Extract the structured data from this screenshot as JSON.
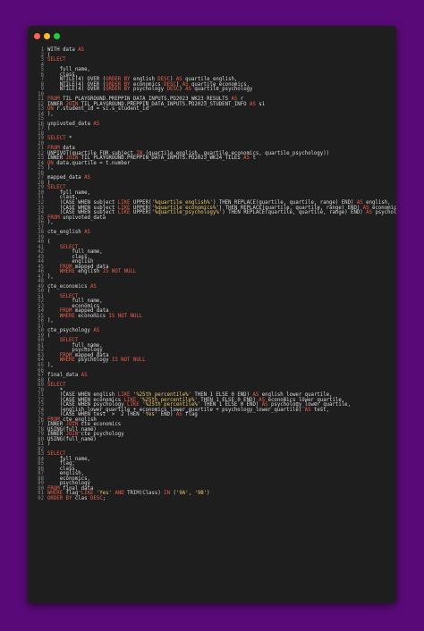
{
  "window": {
    "traffic_lights": [
      {
        "name": "close",
        "color": "#ff5f56"
      },
      {
        "name": "minimize",
        "color": "#ffbd2e"
      },
      {
        "name": "maximize",
        "color": "#27c93f"
      }
    ]
  },
  "colors": {
    "background": "#5a0a78",
    "editor": "#1e1e1e",
    "text": "#d8d8d8",
    "keyword": "#e2604a",
    "string": "#e8c46a",
    "line_number": "#8a8a8a"
  },
  "lines": [
    [
      [
        "t",
        "WITH data "
      ],
      [
        "k",
        "AS"
      ]
    ],
    [
      [
        "t",
        "("
      ]
    ],
    [
      [
        "k",
        "SELECT"
      ]
    ],
    [
      [
        "t",
        ""
      ]
    ],
    [
      [
        "t",
        "    full_name,"
      ]
    ],
    [
      [
        "t",
        "    class,"
      ]
    ],
    [
      [
        "t",
        "    NTILE(4) OVER ("
      ],
      [
        "k",
        "ORDER BY"
      ],
      [
        "t",
        " english "
      ],
      [
        "k",
        "DESC"
      ],
      [
        "t",
        ") "
      ],
      [
        "k",
        "AS"
      ],
      [
        "t",
        " quartile_english,"
      ]
    ],
    [
      [
        "t",
        "    NTILE(4) OVER ("
      ],
      [
        "k",
        "ORDER BY"
      ],
      [
        "t",
        " economics "
      ],
      [
        "k",
        "DESC"
      ],
      [
        "t",
        ") "
      ],
      [
        "k",
        "AS"
      ],
      [
        "t",
        " quartile_economics,"
      ]
    ],
    [
      [
        "t",
        "    NTILE(4) OVER ("
      ],
      [
        "k",
        "ORDER BY"
      ],
      [
        "t",
        " psychology "
      ],
      [
        "k",
        "DESC"
      ],
      [
        "t",
        ") "
      ],
      [
        "k",
        "AS"
      ],
      [
        "t",
        " quartile_psychology"
      ]
    ],
    [
      [
        "t",
        ""
      ]
    ],
    [
      [
        "k",
        "FROM"
      ],
      [
        "t",
        " TIL_PLAYGROUND.PREPPIN_DATA_INPUTS.PD2023_WK23_RESULTS "
      ],
      [
        "k",
        "AS"
      ],
      [
        "t",
        " r"
      ]
    ],
    [
      [
        "t",
        "INNER "
      ],
      [
        "k",
        "JOIN"
      ],
      [
        "t",
        " TIL_PLAYGROUND.PREPPIN_DATA_INPUTS.PD2023_STUDENT_INFO "
      ],
      [
        "k",
        "AS"
      ],
      [
        "t",
        " si"
      ]
    ],
    [
      [
        "k",
        "ON"
      ],
      [
        "t",
        " r.student_id = si.s_student_id"
      ]
    ],
    [
      [
        "t",
        "),"
      ]
    ],
    [
      [
        "t",
        ""
      ]
    ],
    [
      [
        "t",
        "unpivoted_data "
      ],
      [
        "k",
        "AS"
      ]
    ],
    [
      [
        "t",
        "("
      ]
    ],
    [
      [
        "t",
        ""
      ]
    ],
    [
      [
        "k",
        "SELECT"
      ],
      [
        "t",
        " *"
      ]
    ],
    [
      [
        "t",
        ""
      ]
    ],
    [
      [
        "k",
        "FROM"
      ],
      [
        "t",
        " data"
      ]
    ],
    [
      [
        "t",
        "UNPIVOT(quartile FOR subject "
      ],
      [
        "k",
        "IN"
      ],
      [
        "t",
        " (quartile_english, quartile_economics, quartile_psychology))"
      ]
    ],
    [
      [
        "t",
        "INNER "
      ],
      [
        "k",
        "JOIN"
      ],
      [
        "t",
        " TIL_PLAYGROUND.PREPPIN_DATA_INPUTS.PD2023_WK24_TILES "
      ],
      [
        "k",
        "AS"
      ],
      [
        "t",
        " t"
      ]
    ],
    [
      [
        "k",
        "ON"
      ],
      [
        "t",
        " data.quartile = t.number"
      ]
    ],
    [
      [
        "t",
        "),"
      ]
    ],
    [
      [
        "t",
        ""
      ]
    ],
    [
      [
        "t",
        "mapped_data "
      ],
      [
        "k",
        "AS"
      ]
    ],
    [
      [
        "t",
        "("
      ]
    ],
    [
      [
        "k",
        "SELECT"
      ]
    ],
    [
      [
        "t",
        "    full_name,"
      ]
    ],
    [
      [
        "t",
        "    class,"
      ]
    ],
    [
      [
        "t",
        "    (CASE WHEN subject "
      ],
      [
        "k",
        "LIKE"
      ],
      [
        "t",
        " UPPER("
      ],
      [
        "s",
        "'%quartile_english%'"
      ],
      [
        "t",
        ") THEN REPLACE(quartile, quartile, range) END) "
      ],
      [
        "k",
        "AS"
      ],
      [
        "t",
        " english,"
      ]
    ],
    [
      [
        "t",
        "    (CASE WHEN subject "
      ],
      [
        "k",
        "LIKE"
      ],
      [
        "t",
        " UPPER("
      ],
      [
        "s",
        "'%quartile_economics%'"
      ],
      [
        "t",
        ") THEN REPLACE(quartile, quartile, range) END) "
      ],
      [
        "k",
        "AS"
      ],
      [
        "t",
        " economics,"
      ]
    ],
    [
      [
        "t",
        "    (CASE WHEN subject "
      ],
      [
        "k",
        "LIKE"
      ],
      [
        "t",
        " UPPER("
      ],
      [
        "s",
        "'%quartile_psychology%'"
      ],
      [
        "t",
        ") THEN REPLACE(quartile, quartile, range) END) "
      ],
      [
        "k",
        "AS"
      ],
      [
        "t",
        " psychology"
      ]
    ],
    [
      [
        "k",
        "FROM"
      ],
      [
        "t",
        " unpivoted_data"
      ]
    ],
    [
      [
        "t",
        "),"
      ]
    ],
    [
      [
        "t",
        ""
      ]
    ],
    [
      [
        "t",
        "cte_english "
      ],
      [
        "k",
        "AS"
      ]
    ],
    [
      [
        "t",
        ""
      ]
    ],
    [
      [
        "t",
        "("
      ]
    ],
    [
      [
        "t",
        "    "
      ],
      [
        "k",
        "SELECT"
      ]
    ],
    [
      [
        "t",
        "        full_name,"
      ]
    ],
    [
      [
        "t",
        "        class,"
      ]
    ],
    [
      [
        "t",
        "        english"
      ]
    ],
    [
      [
        "t",
        "    "
      ],
      [
        "k",
        "FROM"
      ],
      [
        "t",
        " mapped_data"
      ]
    ],
    [
      [
        "t",
        "    "
      ],
      [
        "k",
        "WHERE"
      ],
      [
        "t",
        " english "
      ],
      [
        "k",
        "IS NOT NULL"
      ]
    ],
    [
      [
        "t",
        "),"
      ]
    ],
    [
      [
        "t",
        ""
      ]
    ],
    [
      [
        "t",
        "cte_economics "
      ],
      [
        "k",
        "AS"
      ]
    ],
    [
      [
        "t",
        "("
      ]
    ],
    [
      [
        "t",
        "    "
      ],
      [
        "k",
        "SELECT"
      ]
    ],
    [
      [
        "t",
        "        full_name,"
      ]
    ],
    [
      [
        "t",
        "        economics"
      ]
    ],
    [
      [
        "t",
        "    "
      ],
      [
        "k",
        "FROM"
      ],
      [
        "t",
        " mapped_data"
      ]
    ],
    [
      [
        "t",
        "    "
      ],
      [
        "k",
        "WHERE"
      ],
      [
        "t",
        " economics "
      ],
      [
        "k",
        "IS NOT NULL"
      ]
    ],
    [
      [
        "t",
        "),"
      ]
    ],
    [
      [
        "t",
        ""
      ]
    ],
    [
      [
        "t",
        "cte_psychology "
      ],
      [
        "k",
        "AS"
      ]
    ],
    [
      [
        "t",
        "("
      ]
    ],
    [
      [
        "t",
        "    "
      ],
      [
        "k",
        "SELECT"
      ]
    ],
    [
      [
        "t",
        "        full_name,"
      ]
    ],
    [
      [
        "t",
        "        psychology"
      ]
    ],
    [
      [
        "t",
        "    "
      ],
      [
        "k",
        "FROM"
      ],
      [
        "t",
        " mapped_data"
      ]
    ],
    [
      [
        "t",
        "    "
      ],
      [
        "k",
        "WHERE"
      ],
      [
        "t",
        " psychology "
      ],
      [
        "k",
        "IS NOT NULL"
      ]
    ],
    [
      [
        "t",
        "),"
      ]
    ],
    [
      [
        "t",
        ""
      ]
    ],
    [
      [
        "t",
        "final_data "
      ],
      [
        "k",
        "AS"
      ]
    ],
    [
      [
        "t",
        "("
      ]
    ],
    [
      [
        "k",
        "SELECT"
      ]
    ],
    [
      [
        "t",
        "    *,"
      ]
    ],
    [
      [
        "t",
        "    (CASE WHEN english "
      ],
      [
        "k",
        "LIKE"
      ],
      [
        "t",
        " "
      ],
      [
        "s",
        "'%25th percentile%'"
      ],
      [
        "t",
        " THEN 1 ELSE 0 END) "
      ],
      [
        "k",
        "AS"
      ],
      [
        "t",
        " english_lower_quartile,"
      ]
    ],
    [
      [
        "t",
        "    (CASE WHEN economics "
      ],
      [
        "k",
        "LIKE"
      ],
      [
        "t",
        " "
      ],
      [
        "s",
        "'%25th percentile%'"
      ],
      [
        "t",
        " THEN 1 ELSE 0 END) "
      ],
      [
        "k",
        "AS"
      ],
      [
        "t",
        " economics_lower_quartile,"
      ]
    ],
    [
      [
        "t",
        "    (CASE WHEN psychology "
      ],
      [
        "k",
        "LIKE"
      ],
      [
        "t",
        " "
      ],
      [
        "s",
        "'%25th percentile%'"
      ],
      [
        "t",
        " THEN 1 ELSE 0 END) "
      ],
      [
        "k",
        "AS"
      ],
      [
        "t",
        " psychology_lower_quartile,"
      ]
    ],
    [
      [
        "t",
        "    (english_lower_quartile + economics_lower_quartile + psychology_lower_quartile) "
      ],
      [
        "k",
        "AS"
      ],
      [
        "t",
        " test,"
      ]
    ],
    [
      [
        "t",
        "    (CASE WHEN test  >  2 THEN "
      ],
      [
        "s",
        "'Yes'"
      ],
      [
        "t",
        " END) "
      ],
      [
        "k",
        "AS"
      ],
      [
        "t",
        " flag"
      ]
    ],
    [
      [
        "k",
        "FROM"
      ],
      [
        "t",
        " cte_english"
      ]
    ],
    [
      [
        "t",
        "INNER "
      ],
      [
        "k",
        "JOIN"
      ],
      [
        "t",
        " cte_economics"
      ]
    ],
    [
      [
        "t",
        "USING(full_name)"
      ]
    ],
    [
      [
        "t",
        "INNER "
      ],
      [
        "k",
        "JOIN"
      ],
      [
        "t",
        " cte_psychology"
      ]
    ],
    [
      [
        "t",
        "USING(full_name)"
      ]
    ],
    [
      [
        "t",
        ")"
      ]
    ],
    [
      [
        "t",
        ""
      ]
    ],
    [
      [
        "k",
        "SELECT"
      ]
    ],
    [
      [
        "t",
        "    full_name,"
      ]
    ],
    [
      [
        "t",
        "    flag,"
      ]
    ],
    [
      [
        "t",
        "    class,"
      ]
    ],
    [
      [
        "t",
        "    english,"
      ]
    ],
    [
      [
        "t",
        "    economics,"
      ]
    ],
    [
      [
        "t",
        "    psychology"
      ]
    ],
    [
      [
        "k",
        "FROM"
      ],
      [
        "t",
        " final_data"
      ]
    ],
    [
      [
        "k",
        "WHERE"
      ],
      [
        "t",
        " flag "
      ],
      [
        "k",
        "LIKE"
      ],
      [
        "t",
        " "
      ],
      [
        "s",
        "'Yes'"
      ],
      [
        "t",
        " "
      ],
      [
        "k",
        "AND"
      ],
      [
        "t",
        " TRIM(Class) "
      ],
      [
        "k",
        "IN"
      ],
      [
        "t",
        " ("
      ],
      [
        "s",
        "'9A'"
      ],
      [
        "t",
        ", "
      ],
      [
        "s",
        "'9B'"
      ],
      [
        "t",
        ")"
      ]
    ],
    [
      [
        "k",
        "ORDER BY"
      ],
      [
        "t",
        " clas "
      ],
      [
        "k",
        "DESC"
      ],
      [
        "t",
        ";"
      ]
    ]
  ]
}
